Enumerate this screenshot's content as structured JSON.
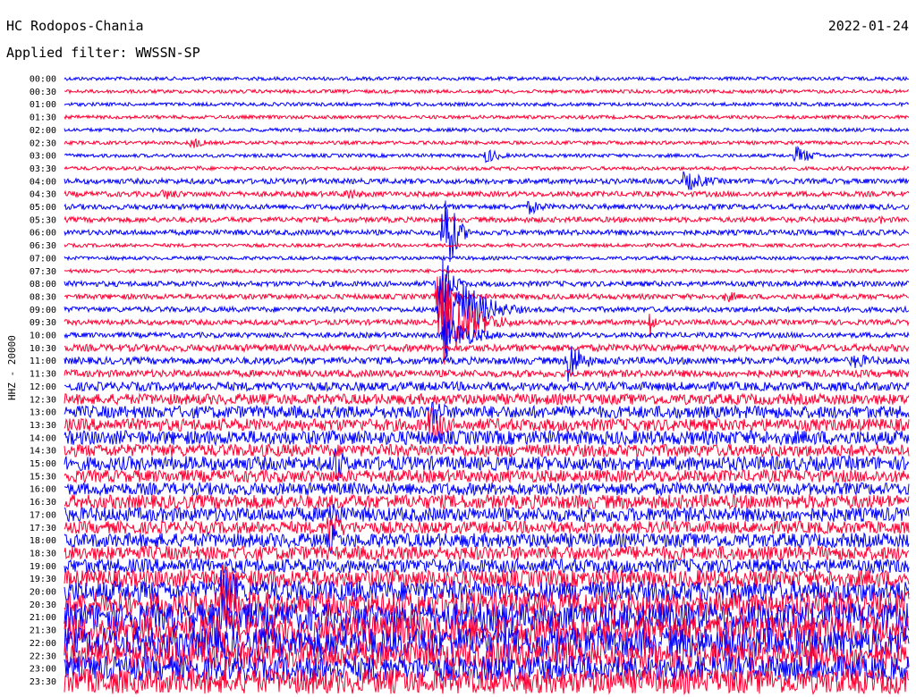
{
  "header": {
    "station": "HC Rodopos-Chania",
    "date": "2022-01-24",
    "filter": "Applied filter: WWSSN-SP",
    "channel_label": "HHZ - 20000"
  },
  "colors": {
    "trace_a": "#0000ff",
    "trace_b": "#ff0033",
    "background": "#ffffff"
  },
  "chart_data": {
    "type": "helicorder",
    "title": "HC Rodopos-Chania",
    "date": "2022-01-24",
    "ylabel": "HHZ - 20000",
    "line_minutes": 30,
    "lines": 48,
    "series_colors": [
      "#0000ff",
      "#ff0033"
    ],
    "y_tick_labels": [
      "00:00",
      "00:30",
      "01:00",
      "01:30",
      "02:00",
      "02:30",
      "03:00",
      "03:30",
      "04:00",
      "04:30",
      "05:00",
      "05:30",
      "06:00",
      "06:30",
      "07:00",
      "07:30",
      "08:00",
      "08:30",
      "09:00",
      "09:30",
      "10:00",
      "10:30",
      "11:00",
      "11:30",
      "12:00",
      "12:30",
      "13:00",
      "13:30",
      "14:00",
      "14:30",
      "15:00",
      "15:30",
      "16:00",
      "16:30",
      "17:00",
      "17:30",
      "18:00",
      "18:30",
      "19:00",
      "19:30",
      "20:00",
      "20:30",
      "21:00",
      "21:30",
      "22:00",
      "22:30",
      "23:00",
      "23:30"
    ],
    "noise_level": [
      2,
      2,
      2,
      2,
      2,
      2,
      2,
      2,
      3,
      3,
      3,
      3,
      3,
      2,
      2,
      2,
      3,
      3,
      3,
      3,
      3,
      4,
      4,
      4,
      5,
      6,
      7,
      7,
      8,
      7,
      8,
      7,
      7,
      8,
      8,
      7,
      8,
      8,
      8,
      10,
      12,
      14,
      16,
      17,
      17,
      16,
      14,
      14
    ],
    "events": [
      {
        "line": 5,
        "minute": 4.5,
        "amplitude": 8,
        "duration": 1.5
      },
      {
        "line": 6,
        "minute": 15,
        "amplitude": 10,
        "duration": 1.5
      },
      {
        "line": 6,
        "minute": 26,
        "amplitude": 11,
        "duration": 2
      },
      {
        "line": 7,
        "minute": 4.7,
        "amplitude": 4,
        "duration": 1
      },
      {
        "line": 8,
        "minute": 22,
        "amplitude": 12,
        "duration": 3
      },
      {
        "line": 9,
        "minute": 3.5,
        "amplitude": 7,
        "duration": 3
      },
      {
        "line": 9,
        "minute": 10,
        "amplitude": 8,
        "duration": 2
      },
      {
        "line": 10,
        "minute": 16.5,
        "amplitude": 9,
        "duration": 2
      },
      {
        "line": 11,
        "minute": 29,
        "amplitude": 5,
        "duration": 1
      },
      {
        "line": 12,
        "minute": 13.5,
        "amplitude": 70,
        "duration": 1
      },
      {
        "line": 16,
        "minute": 13.3,
        "amplitude": 60,
        "duration": 1
      },
      {
        "line": 17,
        "minute": 13.3,
        "amplitude": 50,
        "duration": 1
      },
      {
        "line": 17,
        "minute": 23.5,
        "amplitude": 8,
        "duration": 1.5
      },
      {
        "line": 18,
        "minute": 13.4,
        "amplitude": 70,
        "duration": 3
      },
      {
        "line": 19,
        "minute": 13.4,
        "amplitude": 55,
        "duration": 3
      },
      {
        "line": 19,
        "minute": 20.8,
        "amplitude": 20,
        "duration": 0.5
      },
      {
        "line": 20,
        "minute": 13.5,
        "amplitude": 25,
        "duration": 3
      },
      {
        "line": 22,
        "minute": 17.9,
        "amplitude": 30,
        "duration": 1.5
      },
      {
        "line": 22,
        "minute": 28,
        "amplitude": 10,
        "duration": 3
      },
      {
        "line": 26,
        "minute": 13.0,
        "amplitude": 25,
        "duration": 1.5
      },
      {
        "line": 27,
        "minute": 13.0,
        "amplitude": 30,
        "duration": 1.5
      },
      {
        "line": 30,
        "minute": 9.6,
        "amplitude": 30,
        "duration": 1
      },
      {
        "line": 34,
        "minute": 9.4,
        "amplitude": 25,
        "duration": 1.5
      },
      {
        "line": 35,
        "minute": 9.4,
        "amplitude": 25,
        "duration": 1.5
      },
      {
        "line": 36,
        "minute": 9.5,
        "amplitude": 20,
        "duration": 1
      },
      {
        "line": 39,
        "minute": 5.6,
        "amplitude": 25,
        "duration": 1
      },
      {
        "line": 40,
        "minute": 5.6,
        "amplitude": 40,
        "duration": 2
      },
      {
        "line": 41,
        "minute": 5.6,
        "amplitude": 40,
        "duration": 2
      },
      {
        "line": 42,
        "minute": 5.6,
        "amplitude": 30,
        "duration": 2
      },
      {
        "line": 43,
        "minute": 5.6,
        "amplitude": 30,
        "duration": 2
      },
      {
        "line": 44,
        "minute": 23.5,
        "amplitude": 25,
        "duration": 1
      }
    ]
  }
}
